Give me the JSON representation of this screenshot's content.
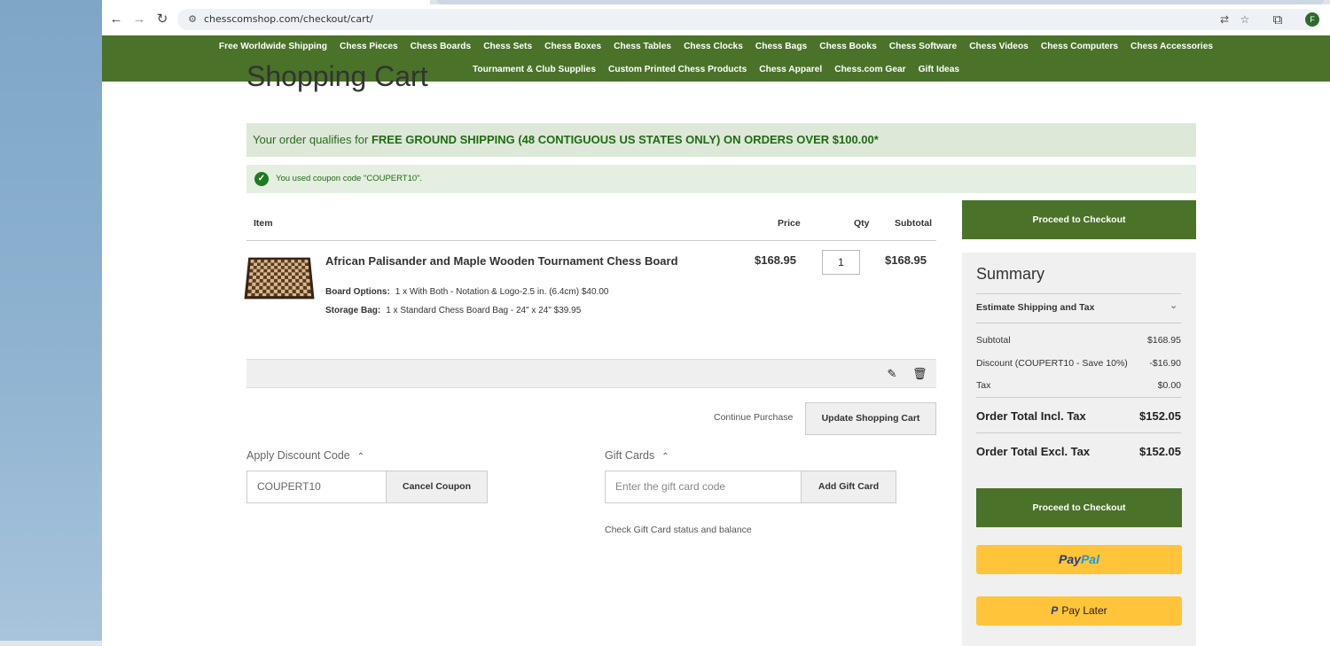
{
  "browser": {
    "url": "chesscomshop.com/checkout/cart/",
    "profile_initial": "F"
  },
  "nav": {
    "row1": [
      "Free Worldwide Shipping",
      "Chess Pieces",
      "Chess Boards",
      "Chess Sets",
      "Chess Boxes",
      "Chess Tables",
      "Chess Clocks",
      "Chess Bags",
      "Chess Books",
      "Chess Software",
      "Chess Videos",
      "Chess Computers",
      "Chess Accessories"
    ],
    "row2": [
      "Tournament & Club Supplies",
      "Custom Printed Chess Products",
      "Chess Apparel",
      "Chess.com Gear",
      "Gift Ideas"
    ]
  },
  "page": {
    "title": "Shopping Cart",
    "shipping_banner_prefix": "Your order qualifies for ",
    "shipping_banner_bold": "FREE GROUND SHIPPING (48 CONTIGUOUS US STATES ONLY) ON ORDERS OVER $100.00*",
    "coupon_message": "You used coupon code \"COUPERT10\"."
  },
  "cart": {
    "headers": {
      "item": "Item",
      "price": "Price",
      "qty": "Qty",
      "subtotal": "Subtotal"
    },
    "item": {
      "name": "African Palisander and Maple Wooden Tournament Chess Board",
      "price": "$168.95",
      "qty": "1",
      "subtotal": "$168.95",
      "options": [
        {
          "label": "Board Options:",
          "value": "1 x With Both - Notation & Logo-2.5 in. (6.4cm) $40.00"
        },
        {
          "label": "Storage Bag:",
          "value": "1 x Standard Chess Board Bag - 24\" x 24\" $39.95"
        }
      ]
    },
    "continue_label": "Continue Purchase",
    "update_label": "Update Shopping Cart"
  },
  "discount": {
    "label": "Apply Discount Code",
    "value": "COUPERT10",
    "button": "Cancel Coupon"
  },
  "giftcard": {
    "label": "Gift Cards",
    "placeholder": "Enter the gift card code",
    "button": "Add Gift Card",
    "status_link": "Check Gift Card status and balance"
  },
  "summary": {
    "checkout_label": "Proceed to Checkout",
    "title": "Summary",
    "estimate_label": "Estimate Shipping and Tax",
    "rows": [
      {
        "label": "Subtotal",
        "value": "$168.95"
      },
      {
        "label": "Discount (COUPERT10 - Save 10%)",
        "value": "-$16.90"
      },
      {
        "label": "Tax",
        "value": "$0.00"
      }
    ],
    "total_incl_label": "Order Total Incl. Tax",
    "total_incl_value": "$152.05",
    "total_excl_label": "Order Total Excl. Tax",
    "total_excl_value": "$152.05",
    "paypal_pay": "Pay",
    "paypal_pal": "Pal",
    "paylater_label": "Pay Later"
  },
  "colors": {
    "brand_green": "#4a7228",
    "banner_bg": "#dde8d9",
    "paypal_yellow": "#ffc439"
  }
}
